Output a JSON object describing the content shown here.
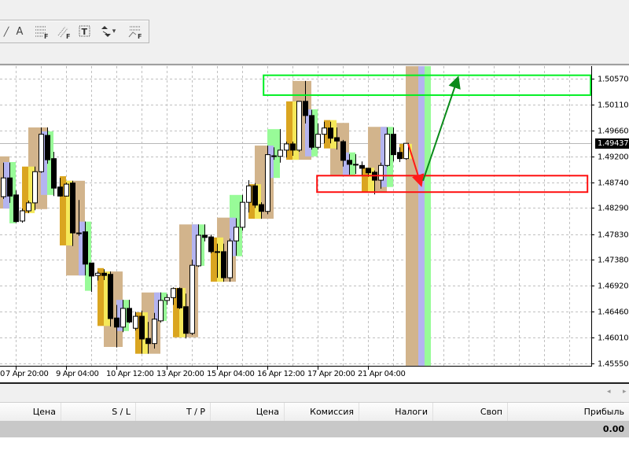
{
  "toolbar": {
    "items": [
      {
        "name": "line-tool",
        "glyph": "╱"
      },
      {
        "name": "text-tool",
        "glyph": "A"
      },
      {
        "name": "fibo-levels-tool",
        "glyph": "F"
      },
      {
        "name": "fibo-channel-tool",
        "glyph": "F"
      },
      {
        "name": "text-label-tool",
        "glyph": "T"
      },
      {
        "name": "arrows-tool",
        "glyph": "⬍"
      },
      {
        "name": "fibo-expansion-tool",
        "glyph": "F"
      }
    ],
    "dropdown_glyph": "▾"
  },
  "colors": {
    "tan": "#d2b48c",
    "orange": "#daa520",
    "yellow": "#f5e85a",
    "lavender": "#b4b4f0",
    "green": "#98fb98",
    "bull": "#ffffff",
    "bear": "#000000",
    "grid": "#c0c0c0",
    "target_box": "#00ee22",
    "stop_box": "#ff1010",
    "up_arrow": "#0a8a1a",
    "down_arrow": "#ff1a1a"
  },
  "chart_data": {
    "type": "candlestick",
    "current_price": "1.49437",
    "current_price_value": 1.49437,
    "y_ticks": [
      "1.50570",
      "1.50110",
      "1.49660",
      "1.49200",
      "1.48740",
      "1.48290",
      "1.47830",
      "1.47380",
      "1.46920",
      "1.46460",
      "1.46010",
      "1.45550"
    ],
    "x_labels": [
      {
        "idx": -5,
        "text": "0"
      },
      {
        "idx": 2,
        "text": "7 Apr 20:00"
      },
      {
        "idx": 10,
        "text": "9 Apr 04:00"
      },
      {
        "idx": 18,
        "text": "10 Apr 12:00"
      },
      {
        "idx": 26,
        "text": "13 Apr 20:00"
      },
      {
        "idx": 34,
        "text": "15 Apr 04:00"
      },
      {
        "idx": 42,
        "text": "16 Apr 12:00"
      },
      {
        "idx": 50,
        "text": "17 Apr 20:00"
      },
      {
        "idx": 58,
        "text": "21 Apr 04:00"
      }
    ],
    "ohlc": [
      [
        1.4849,
        1.4909,
        1.4845,
        1.4882
      ],
      [
        1.4882,
        1.4909,
        1.4838,
        1.485
      ],
      [
        1.4852,
        1.486,
        1.4803,
        1.4805
      ],
      [
        1.4806,
        1.4828,
        1.4803,
        1.4824
      ],
      [
        1.4824,
        1.4842,
        1.482,
        1.4838
      ],
      [
        1.4838,
        1.4902,
        1.4825,
        1.4893
      ],
      [
        1.4893,
        1.4971,
        1.4891,
        1.4959
      ],
      [
        1.4957,
        1.4971,
        1.4907,
        1.4914
      ],
      [
        1.4916,
        1.4928,
        1.485,
        1.4864
      ],
      [
        1.4866,
        1.4882,
        1.4849,
        1.485
      ],
      [
        1.485,
        1.4874,
        1.4849,
        1.4871
      ],
      [
        1.4873,
        1.4877,
        1.4762,
        1.4785
      ],
      [
        1.4785,
        1.4843,
        1.478,
        1.4784
      ],
      [
        1.4787,
        1.4805,
        1.471,
        1.473
      ],
      [
        1.4732,
        1.4732,
        1.4681,
        1.4709
      ],
      [
        1.471,
        1.4717,
        1.4701,
        1.4714
      ],
      [
        1.4714,
        1.4721,
        1.4702,
        1.471
      ],
      [
        1.4712,
        1.4717,
        1.462,
        1.4634
      ],
      [
        1.4635,
        1.4658,
        1.4583,
        1.4619
      ],
      [
        1.4619,
        1.4667,
        1.461,
        1.4652
      ],
      [
        1.4652,
        1.4667,
        1.4626,
        1.4628
      ],
      [
        1.4617,
        1.4646,
        1.4613,
        1.4638
      ],
      [
        1.4638,
        1.4648,
        1.4572,
        1.4598
      ],
      [
        1.4599,
        1.4628,
        1.4572,
        1.459
      ],
      [
        1.459,
        1.4644,
        1.4581,
        1.4633
      ],
      [
        1.463,
        1.468,
        1.4627,
        1.4666
      ],
      [
        1.4666,
        1.4677,
        1.4658,
        1.4671
      ],
      [
        1.4671,
        1.4689,
        1.4658,
        1.4687
      ],
      [
        1.4687,
        1.4689,
        1.4651,
        1.4653
      ],
      [
        1.4655,
        1.4678,
        1.4599,
        1.4608
      ],
      [
        1.4608,
        1.4738,
        1.4605,
        1.4728
      ],
      [
        1.4727,
        1.48,
        1.4725,
        1.4781
      ],
      [
        1.4781,
        1.48,
        1.477,
        1.4777
      ],
      [
        1.4778,
        1.4782,
        1.4749,
        1.4752
      ],
      [
        1.4752,
        1.4766,
        1.4706,
        1.4751
      ],
      [
        1.4752,
        1.4766,
        1.4699,
        1.4706
      ],
      [
        1.4706,
        1.4775,
        1.4699,
        1.4771
      ],
      [
        1.4771,
        1.4811,
        1.4745,
        1.4795
      ],
      [
        1.4795,
        1.4852,
        1.4789,
        1.4839
      ],
      [
        1.4839,
        1.4878,
        1.4821,
        1.4868
      ],
      [
        1.4868,
        1.4873,
        1.4829,
        1.4834
      ],
      [
        1.4835,
        1.4839,
        1.481,
        1.4823
      ],
      [
        1.4823,
        1.4939,
        1.4818,
        1.4923
      ],
      [
        1.4921,
        1.4936,
        1.4914,
        1.492
      ],
      [
        1.492,
        1.4968,
        1.4909,
        1.4931
      ],
      [
        1.4931,
        1.4946,
        1.4918,
        1.4942
      ],
      [
        1.4942,
        1.4946,
        1.4921,
        1.4931
      ],
      [
        1.4931,
        1.5017,
        1.4928,
        1.5017
      ],
      [
        1.5017,
        1.5053,
        1.4978,
        1.4992
      ],
      [
        1.4992,
        1.5002,
        1.4932,
        1.4936
      ],
      [
        1.4936,
        1.4978,
        1.4932,
        1.4959
      ],
      [
        1.4959,
        1.4981,
        1.4943,
        1.497
      ],
      [
        1.497,
        1.4981,
        1.4943,
        1.4952
      ],
      [
        1.4953,
        1.4971,
        1.4932,
        1.4947
      ],
      [
        1.4946,
        1.4949,
        1.4902,
        1.4913
      ],
      [
        1.4913,
        1.4924,
        1.4888,
        1.4906
      ],
      [
        1.4906,
        1.4924,
        1.4889,
        1.4905
      ],
      [
        1.4904,
        1.4911,
        1.4886,
        1.4899
      ],
      [
        1.4899,
        1.49,
        1.4884,
        1.4891
      ],
      [
        1.4892,
        1.4895,
        1.4853,
        1.4878
      ],
      [
        1.4878,
        1.4909,
        1.4863,
        1.4904
      ],
      [
        1.4904,
        1.4971,
        1.4902,
        1.4959
      ],
      [
        1.4959,
        1.4971,
        1.4911,
        1.4923
      ],
      [
        1.4927,
        1.4936,
        1.491,
        1.4916
      ],
      [
        1.4916,
        1.4943,
        1.4914,
        1.4943
      ]
    ],
    "session_boxes": [
      [
        64,
        66,
        1.5079,
        1.4551,
        "tan"
      ],
      [
        66,
        67,
        1.5079,
        1.4551,
        "lavender"
      ],
      [
        67,
        68,
        1.5079,
        1.4551,
        "green"
      ],
      [
        -0.5,
        1,
        1.492,
        1.4828,
        "tan"
      ],
      [
        0,
        1,
        1.491,
        1.4828,
        "lavender"
      ],
      [
        1,
        2,
        1.491,
        1.4802,
        "green"
      ],
      [
        3,
        4,
        1.4902,
        1.482,
        "orange"
      ],
      [
        4,
        7,
        1.4971,
        1.4827,
        "tan"
      ],
      [
        4,
        5,
        1.4902,
        1.482,
        "yellow"
      ],
      [
        6,
        7,
        1.4964,
        1.4852,
        "lavender"
      ],
      [
        7,
        8,
        1.4964,
        1.4852,
        "green"
      ],
      [
        9,
        10,
        1.4885,
        1.4763,
        "orange"
      ],
      [
        10,
        13,
        1.4877,
        1.471,
        "tan"
      ],
      [
        10,
        11,
        1.4877,
        1.4763,
        "yellow"
      ],
      [
        12,
        13,
        1.4805,
        1.471,
        "lavender"
      ],
      [
        13,
        14,
        1.4805,
        1.4683,
        "green"
      ],
      [
        15,
        16,
        1.4723,
        1.4621,
        "orange"
      ],
      [
        16,
        19,
        1.4717,
        1.4584,
        "tan"
      ],
      [
        16,
        17,
        1.4717,
        1.4621,
        "yellow"
      ],
      [
        18,
        19,
        1.4667,
        1.4612,
        "lavender"
      ],
      [
        19,
        20,
        1.4667,
        1.4612,
        "green"
      ],
      [
        21,
        22,
        1.4645,
        1.4572,
        "orange"
      ],
      [
        22,
        25,
        1.468,
        1.4572,
        "tan"
      ],
      [
        22,
        23,
        1.4645,
        1.4572,
        "yellow"
      ],
      [
        24,
        25,
        1.468,
        1.463,
        "lavender"
      ],
      [
        25,
        26,
        1.468,
        1.463,
        "green"
      ],
      [
        27,
        28,
        1.4688,
        1.4601,
        "orange"
      ],
      [
        28,
        31,
        1.48,
        1.4601,
        "tan"
      ],
      [
        28,
        29,
        1.4688,
        1.4601,
        "yellow"
      ],
      [
        30,
        31,
        1.48,
        1.4727,
        "lavender"
      ],
      [
        31,
        32,
        1.48,
        1.4727,
        "green"
      ],
      [
        33,
        34,
        1.4777,
        1.4699,
        "orange"
      ],
      [
        34,
        37,
        1.4812,
        1.4699,
        "tan"
      ],
      [
        34,
        35,
        1.4777,
        1.4699,
        "yellow"
      ],
      [
        36,
        38,
        1.4852,
        1.4744,
        "green"
      ],
      [
        36,
        37,
        1.4812,
        1.4744,
        "lavender"
      ],
      [
        39,
        40,
        1.4871,
        1.481,
        "orange"
      ],
      [
        40,
        43,
        1.4939,
        1.481,
        "tan"
      ],
      [
        40,
        41,
        1.4871,
        1.481,
        "yellow"
      ],
      [
        42,
        44,
        1.4968,
        1.4882,
        "green"
      ],
      [
        42,
        43,
        1.4939,
        1.4882,
        "lavender"
      ],
      [
        45,
        46,
        1.5017,
        1.4914,
        "orange"
      ],
      [
        46,
        49,
        1.5053,
        1.4914,
        "tan"
      ],
      [
        46,
        47,
        1.5017,
        1.4914,
        "yellow"
      ],
      [
        48,
        49,
        1.5003,
        1.492,
        "lavender"
      ],
      [
        49,
        50,
        1.5003,
        1.492,
        "green"
      ],
      [
        51,
        52,
        1.4984,
        1.4934,
        "orange"
      ],
      [
        52,
        55,
        1.4979,
        1.4886,
        "tan"
      ],
      [
        52,
        53,
        1.4984,
        1.4934,
        "yellow"
      ],
      [
        54,
        55,
        1.4927,
        1.4886,
        "lavender"
      ],
      [
        55,
        56,
        1.4927,
        1.4886,
        "green"
      ],
      [
        57,
        58,
        1.49,
        1.4857,
        "orange"
      ],
      [
        58,
        61,
        1.4972,
        1.4857,
        "tan"
      ],
      [
        58,
        59,
        1.49,
        1.4857,
        "yellow"
      ],
      [
        60,
        61,
        1.4972,
        1.4866,
        "lavender"
      ],
      [
        61,
        62,
        1.4972,
        1.4866,
        "green"
      ],
      [
        63,
        64,
        1.4942,
        1.4916,
        "orange"
      ],
      [
        64,
        65,
        1.4942,
        1.4916,
        "yellow"
      ]
    ],
    "target_zone": {
      "idx": [
        41.4,
        93.4
      ],
      "price": [
        1.5063,
        1.5028
      ]
    },
    "stop_zone": {
      "idx": [
        49.9,
        92.9
      ],
      "price": [
        1.4886,
        1.4857
      ]
    },
    "down_arrow": {
      "from": [
        64.4,
        1.4942
      ],
      "to": [
        66.4,
        1.4871
      ]
    },
    "up_arrow": {
      "from": [
        66.75,
        1.4877
      ],
      "to": [
        72.25,
        1.5057
      ]
    }
  },
  "table": {
    "columns": [
      "Цена",
      "S / L",
      "T / P",
      "Цена",
      "Комиссия",
      "Налоги",
      "Своп",
      "Прибыль"
    ],
    "total_profit": "0.00"
  },
  "scroll": {
    "left": "◂",
    "right": "▸"
  }
}
